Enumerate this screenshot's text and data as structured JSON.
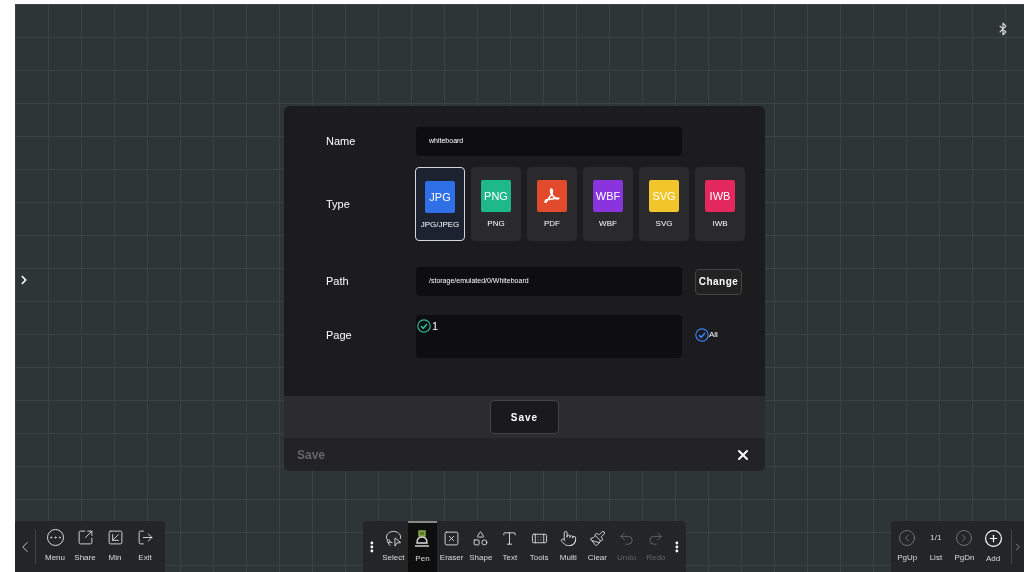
{
  "dialog": {
    "name": {
      "label": "Name",
      "value": "whiteboard"
    },
    "type": {
      "label": "Type",
      "options": [
        {
          "badge": "JPG",
          "label": "JPG/JPEG",
          "color": "#2f6fe8",
          "selected": true
        },
        {
          "badge": "PNG",
          "label": "PNG",
          "color": "#1fb88a",
          "selected": false
        },
        {
          "label": "PDF",
          "color": "#e24a2c",
          "selected": false,
          "kind": "pdf"
        },
        {
          "badge": "WBF",
          "label": "WBF",
          "color": "#8a34e0",
          "selected": false
        },
        {
          "badge": "SVG",
          "label": "SVG",
          "color": "#f2c62a",
          "selected": false
        },
        {
          "badge": "IWB",
          "label": "IWB",
          "color": "#e4285e",
          "selected": false
        }
      ]
    },
    "path": {
      "label": "Path",
      "value": "/storage/emulated/0/Whiteboard",
      "button": "Change"
    },
    "page": {
      "label": "Page",
      "items": [
        {
          "label": "1",
          "checked": true
        }
      ],
      "all": {
        "label": "All",
        "checked": true
      }
    },
    "save_button": "Save",
    "footer_title": "Save"
  },
  "left_toolbar": [
    {
      "label": "Menu"
    },
    {
      "label": "Share"
    },
    {
      "label": "Min"
    },
    {
      "label": "Exit"
    }
  ],
  "center_toolbar": [
    {
      "label": "Select",
      "selected": false,
      "disabled": false
    },
    {
      "label": "Pen",
      "selected": true,
      "disabled": false
    },
    {
      "label": "Eraser",
      "selected": false,
      "disabled": false
    },
    {
      "label": "Shape",
      "selected": false,
      "disabled": false
    },
    {
      "label": "Text",
      "selected": false,
      "disabled": false
    },
    {
      "label": "Tools",
      "selected": false,
      "disabled": false
    },
    {
      "label": "Multi",
      "selected": false,
      "disabled": false
    },
    {
      "label": "Clear",
      "selected": false,
      "disabled": false
    },
    {
      "label": "Undo",
      "selected": false,
      "disabled": true
    },
    {
      "label": "Redo",
      "selected": false,
      "disabled": true
    }
  ],
  "right_toolbar": [
    {
      "kind": "icon",
      "label": "PgUp"
    },
    {
      "kind": "text",
      "value": "1/1",
      "label": "List"
    },
    {
      "kind": "icon",
      "label": "PgDn"
    },
    {
      "kind": "add",
      "label": "Add"
    }
  ]
}
